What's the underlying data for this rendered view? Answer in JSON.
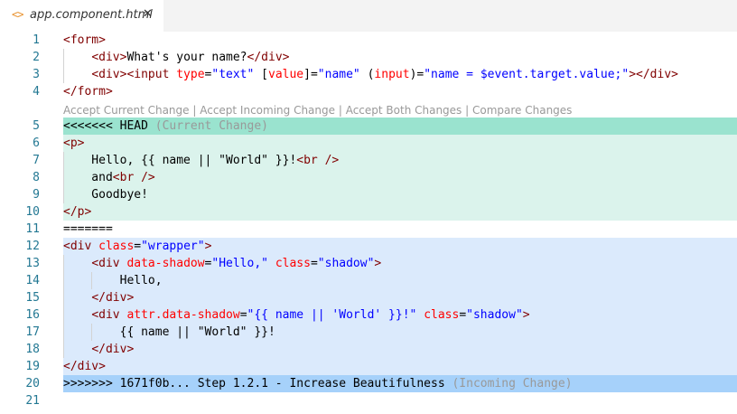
{
  "tab": {
    "icon": "<>",
    "title": "app.component.html",
    "close": "✕"
  },
  "colors": {
    "current_header": "#9ae3cf",
    "current_body": "#dbf3ec",
    "incoming_header": "#a6d1fa",
    "incoming_body": "#dbeafc",
    "line_number": "#237893"
  },
  "codelens": {
    "accept_current": "Accept Current Change",
    "accept_incoming": "Accept Incoming Change",
    "accept_both": "Accept Both Changes",
    "compare": "Compare Changes",
    "separator": " | "
  },
  "lines": [
    {
      "n": "1",
      "tokens": [
        [
          "tag",
          "<form>"
        ]
      ]
    },
    {
      "n": "2",
      "tokens": [
        [
          "text",
          "    "
        ],
        [
          "tag",
          "<div>"
        ],
        [
          "text",
          "What's your name?"
        ],
        [
          "tag",
          "</div>"
        ]
      ]
    },
    {
      "n": "3",
      "tokens": [
        [
          "text",
          "    "
        ],
        [
          "tag",
          "<div><input "
        ],
        [
          "attr",
          "type"
        ],
        [
          "text",
          "="
        ],
        [
          "str",
          "\"text\""
        ],
        [
          "text",
          " ["
        ],
        [
          "attr",
          "value"
        ],
        [
          "text",
          "]="
        ],
        [
          "str",
          "\"name\""
        ],
        [
          "text",
          " ("
        ],
        [
          "attr",
          "input"
        ],
        [
          "text",
          ")="
        ],
        [
          "str",
          "\"name = $event.target.value;\""
        ],
        [
          "tag",
          "></div>"
        ]
      ]
    },
    {
      "n": "4",
      "tokens": [
        [
          "tag",
          "</form>"
        ]
      ]
    },
    {
      "n": "5",
      "tokens": [
        [
          "text",
          "<<<<<<< HEAD "
        ],
        [
          "note",
          "(Current Change)"
        ]
      ]
    },
    {
      "n": "6",
      "tokens": [
        [
          "tag",
          "<p>"
        ]
      ]
    },
    {
      "n": "7",
      "tokens": [
        [
          "text",
          "    Hello, {{ name || \"World\" }}!"
        ],
        [
          "tag",
          "<br />"
        ]
      ]
    },
    {
      "n": "8",
      "tokens": [
        [
          "text",
          "    and"
        ],
        [
          "tag",
          "<br />"
        ]
      ]
    },
    {
      "n": "9",
      "tokens": [
        [
          "text",
          "    Goodbye!"
        ]
      ]
    },
    {
      "n": "10",
      "tokens": [
        [
          "tag",
          "</p>"
        ]
      ]
    },
    {
      "n": "11",
      "tokens": [
        [
          "text",
          "======="
        ]
      ]
    },
    {
      "n": "12",
      "tokens": [
        [
          "tag",
          "<div "
        ],
        [
          "attr",
          "class"
        ],
        [
          "text",
          "="
        ],
        [
          "str",
          "\"wrapper\""
        ],
        [
          "tag",
          ">"
        ]
      ]
    },
    {
      "n": "13",
      "tokens": [
        [
          "text",
          "    "
        ],
        [
          "tag",
          "<div "
        ],
        [
          "attr",
          "data-shadow"
        ],
        [
          "text",
          "="
        ],
        [
          "str",
          "\"Hello,\""
        ],
        [
          "text",
          " "
        ],
        [
          "attr",
          "class"
        ],
        [
          "text",
          "="
        ],
        [
          "str",
          "\"shadow\""
        ],
        [
          "tag",
          ">"
        ]
      ]
    },
    {
      "n": "14",
      "tokens": [
        [
          "text",
          "        Hello,"
        ]
      ]
    },
    {
      "n": "15",
      "tokens": [
        [
          "text",
          "    "
        ],
        [
          "tag",
          "</div>"
        ]
      ]
    },
    {
      "n": "16",
      "tokens": [
        [
          "text",
          "    "
        ],
        [
          "tag",
          "<div "
        ],
        [
          "attr",
          "attr.data-shadow"
        ],
        [
          "text",
          "="
        ],
        [
          "str",
          "\"{{ name || 'World' }}!\""
        ],
        [
          "text",
          " "
        ],
        [
          "attr",
          "class"
        ],
        [
          "text",
          "="
        ],
        [
          "str",
          "\"shadow\""
        ],
        [
          "tag",
          ">"
        ]
      ]
    },
    {
      "n": "17",
      "tokens": [
        [
          "text",
          "        {{ name || \"World\" }}!"
        ]
      ]
    },
    {
      "n": "18",
      "tokens": [
        [
          "text",
          "    "
        ],
        [
          "tag",
          "</div>"
        ]
      ]
    },
    {
      "n": "19",
      "tokens": [
        [
          "tag",
          "</div>"
        ]
      ]
    },
    {
      "n": "20",
      "tokens": [
        [
          "text",
          ">>>>>>> 1671f0b... Step 1.2.1 - Increase Beautifulness "
        ],
        [
          "note",
          "(Incoming Change)"
        ]
      ]
    },
    {
      "n": "21",
      "tokens": []
    }
  ]
}
